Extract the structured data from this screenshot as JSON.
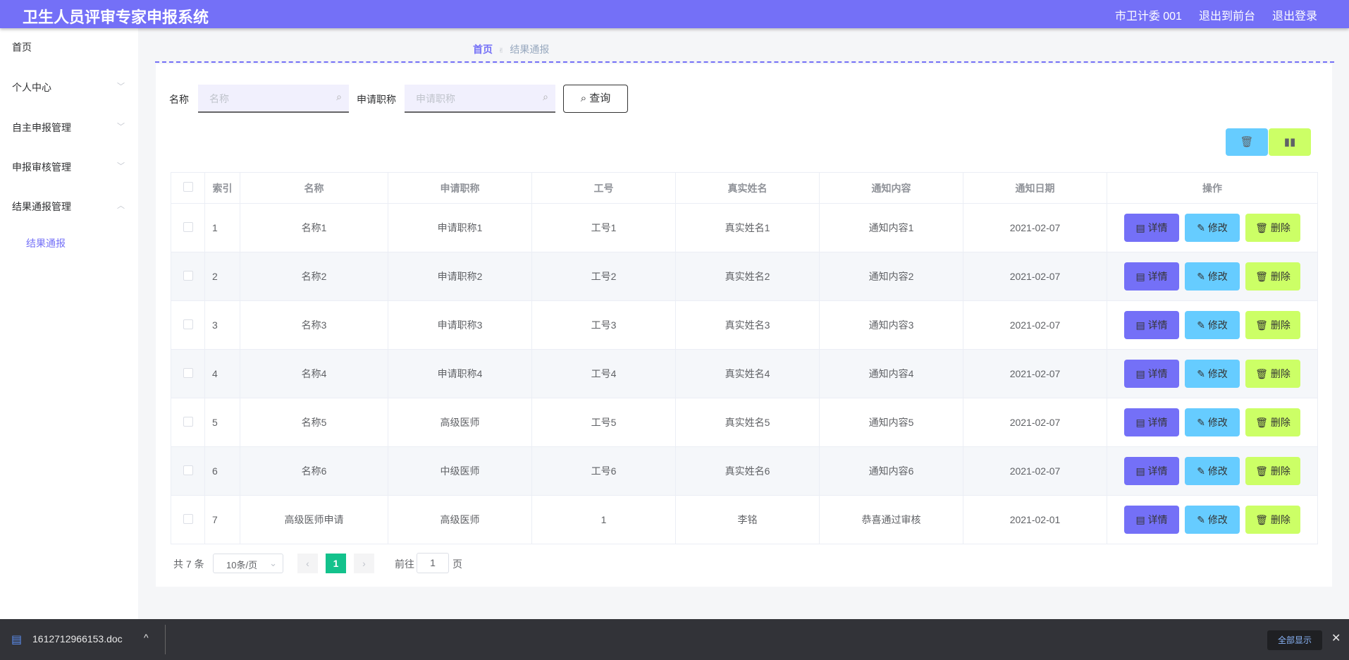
{
  "header": {
    "title": "卫生人员评审专家申报系统",
    "user": "市卫计委 001",
    "front": "退出到前台",
    "logout": "退出登录"
  },
  "sidebar": {
    "items": [
      {
        "label": "首页"
      },
      {
        "label": "个人中心"
      },
      {
        "label": "自主申报管理"
      },
      {
        "label": "申报审核管理"
      },
      {
        "label": "结果通报管理"
      }
    ],
    "sub": "结果通报"
  },
  "breadcrumb": {
    "home": "首页",
    "current": "结果通报"
  },
  "search": {
    "name_label": "名称",
    "name_placeholder": "名称",
    "title_label": "申请职称",
    "title_placeholder": "申请职称",
    "query": "查询"
  },
  "table": {
    "headers": [
      "索引",
      "名称",
      "申请职称",
      "工号",
      "真实姓名",
      "通知内容",
      "通知日期",
      "操作"
    ],
    "rows": [
      [
        "1",
        "名称1",
        "申请职称1",
        "工号1",
        "真实姓名1",
        "通知内容1",
        "2021-02-07"
      ],
      [
        "2",
        "名称2",
        "申请职称2",
        "工号2",
        "真实姓名2",
        "通知内容2",
        "2021-02-07"
      ],
      [
        "3",
        "名称3",
        "申请职称3",
        "工号3",
        "真实姓名3",
        "通知内容3",
        "2021-02-07"
      ],
      [
        "4",
        "名称4",
        "申请职称4",
        "工号4",
        "真实姓名4",
        "通知内容4",
        "2021-02-07"
      ],
      [
        "5",
        "名称5",
        "高级医师",
        "工号5",
        "真实姓名5",
        "通知内容5",
        "2021-02-07"
      ],
      [
        "6",
        "名称6",
        "中级医师",
        "工号6",
        "真实姓名6",
        "通知内容6",
        "2021-02-07"
      ],
      [
        "7",
        "高级医师申请",
        "高级医师",
        "1",
        "李铭",
        "恭喜通过审核",
        "2021-02-01"
      ]
    ],
    "actions": {
      "detail": "详情",
      "edit": "修改",
      "delete": "删除"
    }
  },
  "pagination": {
    "total": "共 7 条",
    "page_size": "10条/页",
    "current": "1",
    "goto": "前往",
    "goto_value": "1",
    "page_unit": "页"
  },
  "download": {
    "file": "1612712966153.doc",
    "show_all": "全部显示"
  },
  "colors": {
    "primary": "#7470f7",
    "info": "#66ccff",
    "lime": "#ccff66",
    "active_page": "#13c28c"
  }
}
